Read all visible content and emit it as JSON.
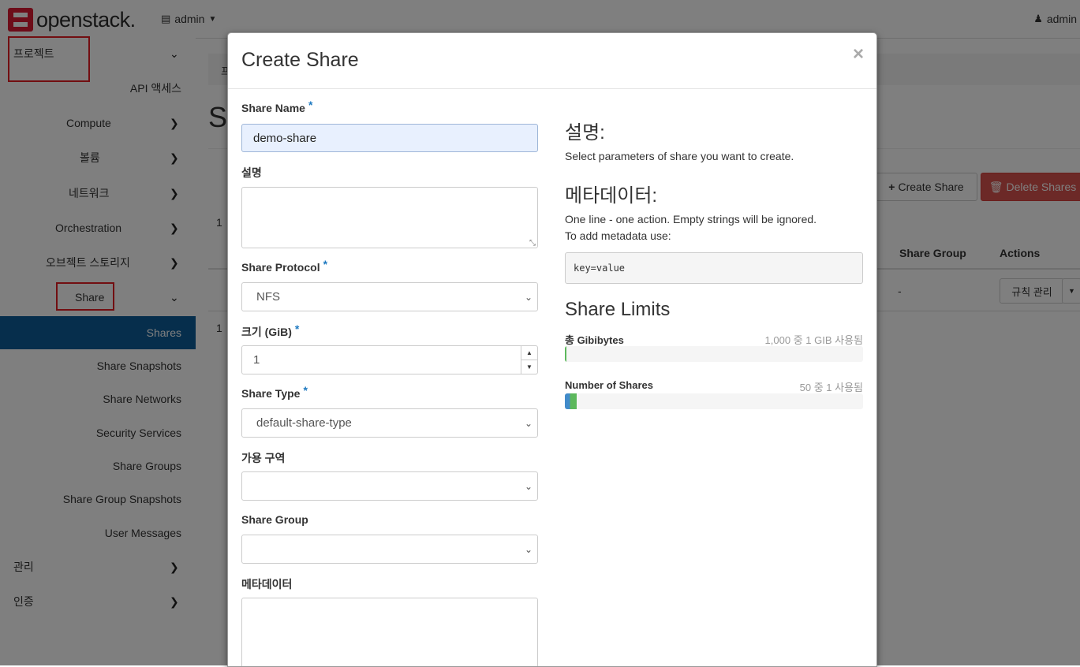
{
  "topbar": {
    "logo": "openstack.",
    "project_switcher": "admin",
    "user": "admin"
  },
  "sidebar": {
    "project": "프로젝트",
    "api_access": "API 액세스",
    "compute": "Compute",
    "volumes": "볼륨",
    "network": "네트워크",
    "orchestration": "Orchestration",
    "object_storage": "오브젝트 스토리지",
    "share": "Share",
    "shares": "Shares",
    "share_snapshots": "Share Snapshots",
    "share_networks": "Share Networks",
    "security_services": "Security Services",
    "share_groups": "Share Groups",
    "share_group_snapshots": "Share Group Snapshots",
    "user_messages": "User Messages",
    "admin": "관리",
    "identity": "인증"
  },
  "background": {
    "breadcrumb_partial": "프",
    "title_partial": "S",
    "create_share_btn": "Create Share",
    "delete_shares_btn": "Delete Shares",
    "items_count_partial": "1",
    "col_share_group": "Share Group",
    "col_actions": "Actions",
    "row_share_group": "-",
    "row_action": "규칙 관리"
  },
  "modal": {
    "title": "Create Share",
    "close": "×",
    "share_name_label": "Share Name",
    "share_name_value": "demo-share",
    "description_label": "설명",
    "protocol_label": "Share Protocol",
    "protocol_value": "NFS",
    "size_label": "크기 (GiB)",
    "size_value": "1",
    "share_type_label": "Share Type",
    "share_type_value": "default-share-type",
    "az_label": "가용 구역",
    "share_group_label": "Share Group",
    "metadata_label": "메타데이터",
    "required_mark": "*",
    "help": {
      "desc_heading": "설명:",
      "desc_text": "Select parameters of share you want to create.",
      "meta_heading": "메타데이터:",
      "meta_line1": "One line - one action. Empty strings will be ignored.",
      "meta_line2": "To add metadata use:",
      "meta_example": "key=value",
      "limits_heading": "Share Limits",
      "gib_label": "총 Gibibytes",
      "gib_usage": "1,000 중 1 GIB 사용됨",
      "gib_used_fraction": 0.001,
      "shares_label": "Number of Shares",
      "shares_usage": "50 중 1 사용됨",
      "shares_used_fraction": 0.02
    }
  }
}
